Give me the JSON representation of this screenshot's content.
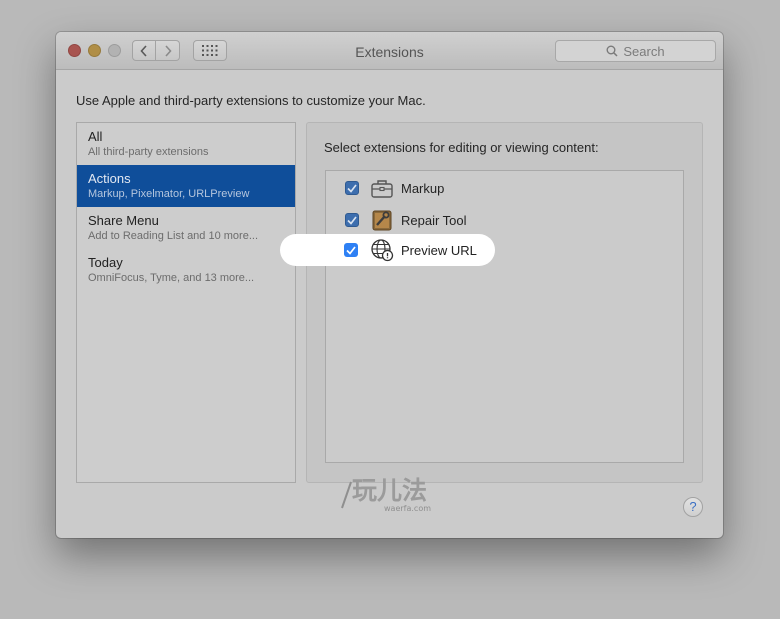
{
  "window": {
    "title": "Extensions",
    "search_placeholder": "Search"
  },
  "intro_text": "Use Apple and third-party extensions to customize your Mac.",
  "categories": [
    {
      "title": "All",
      "subtitle": "All third-party extensions"
    },
    {
      "title": "Actions",
      "subtitle": "Markup, Pixelmator, URLPreview"
    },
    {
      "title": "Share Menu",
      "subtitle": "Add to Reading List and 10 more..."
    },
    {
      "title": "Today",
      "subtitle": "OmniFocus, Tyme, and 13 more..."
    }
  ],
  "selected_category": "Actions",
  "extensions_heading": "Select extensions for editing or viewing content:",
  "extensions": [
    {
      "label": "Markup",
      "checked": true,
      "icon": "toolbox-icon"
    },
    {
      "label": "Repair Tool",
      "checked": true,
      "icon": "repair-tool-icon"
    },
    {
      "label": "Preview URL",
      "checked": true,
      "icon": "globe-icon"
    }
  ],
  "help_label": "?",
  "watermark": {
    "text": "玩儿法",
    "url": "waerfa.com"
  },
  "colors": {
    "selection": "#0f4e9a",
    "checkbox": "#3d6eae",
    "highlight_checkbox": "#2e80f4"
  }
}
